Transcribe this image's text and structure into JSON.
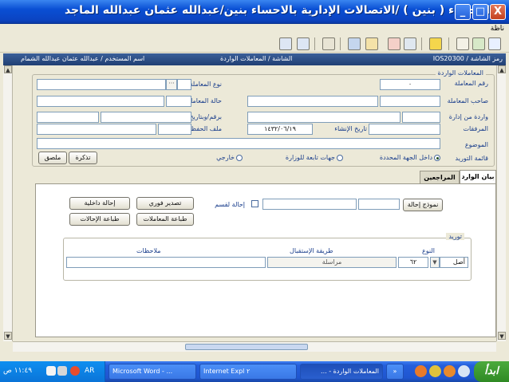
{
  "window": {
    "title": "الاحساء ( بنين ) /الاتصالات الإدارية بالاحساء بنين/عبدالله عثمان عبدالله الماجد",
    "minimize": "_",
    "maximize": "□",
    "close": "X"
  },
  "menu": {
    "help": "ناظة"
  },
  "info_bar": {
    "screen_code": "IOS20300 / رمز الشاشة",
    "screen_path": "الشاشة / المعاملات الواردة",
    "user": "اسم المستخدم / عبدالله عثمان عبدالله الشمام"
  },
  "incoming_group": {
    "title": "المعاملات الواردة",
    "transaction_no_label": "رقم المعاملة",
    "transaction_no_value": "٠",
    "transaction_type_label": "نوع المعاملة",
    "owner_label": "صاحب المعاملة",
    "status_label": "حالة المعاملة",
    "from_dept_label": "واردة من إدارة",
    "ref_date_label": "برقم/وبتاريخ",
    "attachments_label": "المرفقات",
    "created_date_label": "تاريخ الإنشاء",
    "created_date_value": "١٤٣٢/٠٦/١٩",
    "save_file_label": "ملف الحفظ",
    "subject_label": "الموضوع",
    "source_label": "قائمة التوريد",
    "radio_internal": "داخل الجهة المحددة",
    "radio_affiliated": "جهات تابعة للوزارة",
    "radio_external": "خارجي",
    "memo_button": "تذكرة",
    "poster_button": "ملصق"
  },
  "tabs": [
    {
      "label": "بيان الوارد"
    },
    {
      "label": "المراجعين"
    }
  ],
  "actions": {
    "template_button": "نموذج إحالة",
    "refer_dept_label": "إحالة لقسم",
    "immediate_export": "تصدير فوري",
    "internal_referral": "إحالة داخلية",
    "print_transactions": "طباعة المعاملات",
    "print_referrals": "طباعة الإحالات"
  },
  "supply_group": {
    "title": "توريد",
    "type_header": "النوع",
    "receive_method_header": "طريقة الإستقبال",
    "notes_header": "ملاحظات",
    "type_value": "أصل",
    "count_value": "٦٢",
    "method_value": "مراسلة"
  },
  "taskbar": {
    "start": "ابدأ",
    "clock": "١١:٤٩ ص",
    "lang": "AR",
    "tasks": [
      "المعاملات الواردة - ...",
      "Internet Expl ٢",
      "Microsoft Word - ..."
    ],
    "more": "»"
  },
  "colors": {
    "titlebar": "#0a4fd4",
    "form_bg": "#ece9d8",
    "label_blue": "#1a3e8c",
    "taskbar": "#245edb",
    "start": "#3a9a2e"
  }
}
